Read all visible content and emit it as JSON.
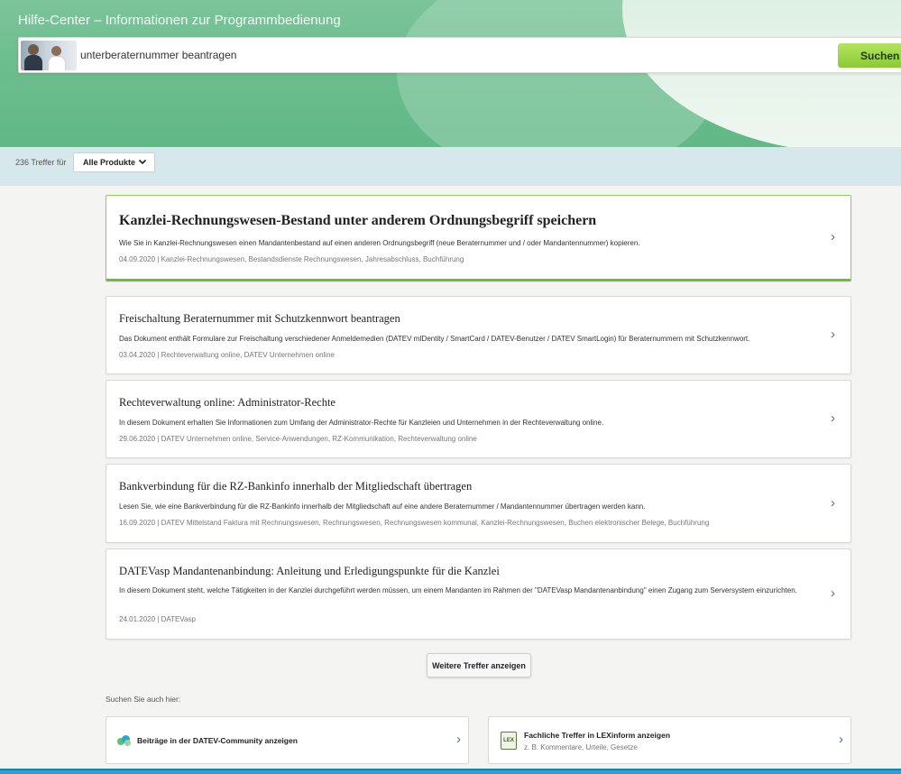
{
  "header": {
    "title": "Hilfe-Center – Informationen zur Programmbedienung"
  },
  "search": {
    "value": "unterberaternummer beantragen",
    "button_label": "Suchen"
  },
  "filter": {
    "hits_text": "236 Treffer für",
    "product_selected": "Alle Produkte"
  },
  "results": [
    {
      "title": "Kanzlei-Rechnungswesen-Bestand unter anderem Ordnungsbegriff speichern",
      "description": "Wie Sie in Kanzlei-Rechnungswesen einen Mandantenbestand auf einen anderen Ordnungsbegriff (neue Beraternummer und / oder Mandantennummer) kopieren.",
      "meta": "04.09.2020 | Kanzlei-Rechnungswesen, Bestandsdienste Rechnungswesen, Jahresabschluss, Buchführung"
    },
    {
      "title": "Freischaltung Beraternummer mit Schutzkennwort beantragen",
      "description": "Das Dokument enthält Formulare zur Freischaltung verschiedener Anmeldemedien (DATEV mIDentity / SmartCard / DATEV-Benutzer / DATEV SmartLogin) für Beraternummern mit Schutzkennwort.",
      "meta": "03.04.2020 | Rechteverwaltung online, DATEV Unternehmen online"
    },
    {
      "title": "Rechteverwaltung online: Administrator-Rechte",
      "description": "In diesem Dokument erhalten Sie Informationen zum Umfang der Administrator-Rechte für Kanzleien und Unternehmen in der Rechteverwaltung online.",
      "meta": "29.06.2020 | DATEV Unternehmen online, Service-Anwendungen, RZ-Kommunikation, Rechteverwaltung online"
    },
    {
      "title": "Bankverbindung für die RZ-Bankinfo innerhalb der Mitgliedschaft übertragen",
      "description": "Lesen Sie, wie eine Bankverbindung für die RZ-Bankinfo innerhalb der Mitgliedschaft auf eine andere Beraternummer / Mandantennummer übertragen werden kann.",
      "meta": "16.09.2020 | DATEV Mittelstand Faktura mit Rechnungswesen, Rechnungswesen, Rechnungswesen kommunal, Kanzlei-Rechnungswesen, Buchen elektronischer Belege, Buchführung"
    },
    {
      "title": "DATEVasp Mandantenanbindung: Anleitung und Erledigungspunkte für die Kanzlei",
      "description": "In diesem Dokument steht, welche Tätigkeiten in der Kanzlei durchgeführt werden müssen, um einem Mandanten im Rahmen der \"DATEVasp Mandantenanbindung\" einen Zugang zum Serversystem einzurichten.",
      "meta": "24.01.2020 | DATEVasp"
    }
  ],
  "more_button_label": "Weitere Treffer anzeigen",
  "also_search_label": "Suchen Sie auch hier:",
  "tiles": {
    "community": {
      "title": "Beiträge in der DATEV-Community anzeigen",
      "icon": "community-icon"
    },
    "lexinform": {
      "title": "Fachliche Treffer in LEXinform anzeigen",
      "subtitle": "z. B. Kommentare, Urteile, Gesetze",
      "icon_text": "LEX"
    }
  },
  "icons": {
    "chevron": "›",
    "dropdown": "⌄"
  },
  "colors": {
    "accent_green": "#8bcb32",
    "header_green": "#6cbd8e",
    "filter_bar": "#d6e8ec",
    "link_arrow": "#4a6f96"
  }
}
